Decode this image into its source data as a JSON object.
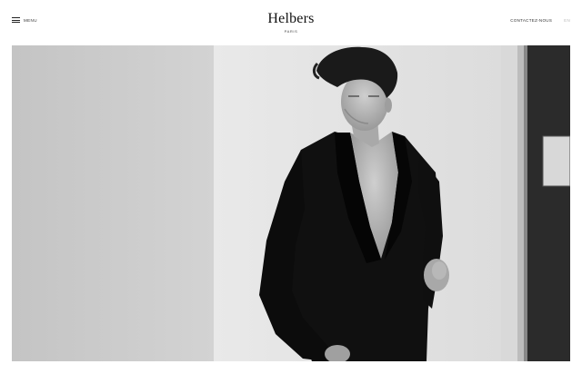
{
  "header": {
    "menu_label": "MENU",
    "brand_name": "Helbers",
    "brand_city": "PARIS",
    "contact_label": "CONTACTEZ-NOUS",
    "lang_label": "EN"
  },
  "hero": {
    "icon": "hero-photo"
  }
}
